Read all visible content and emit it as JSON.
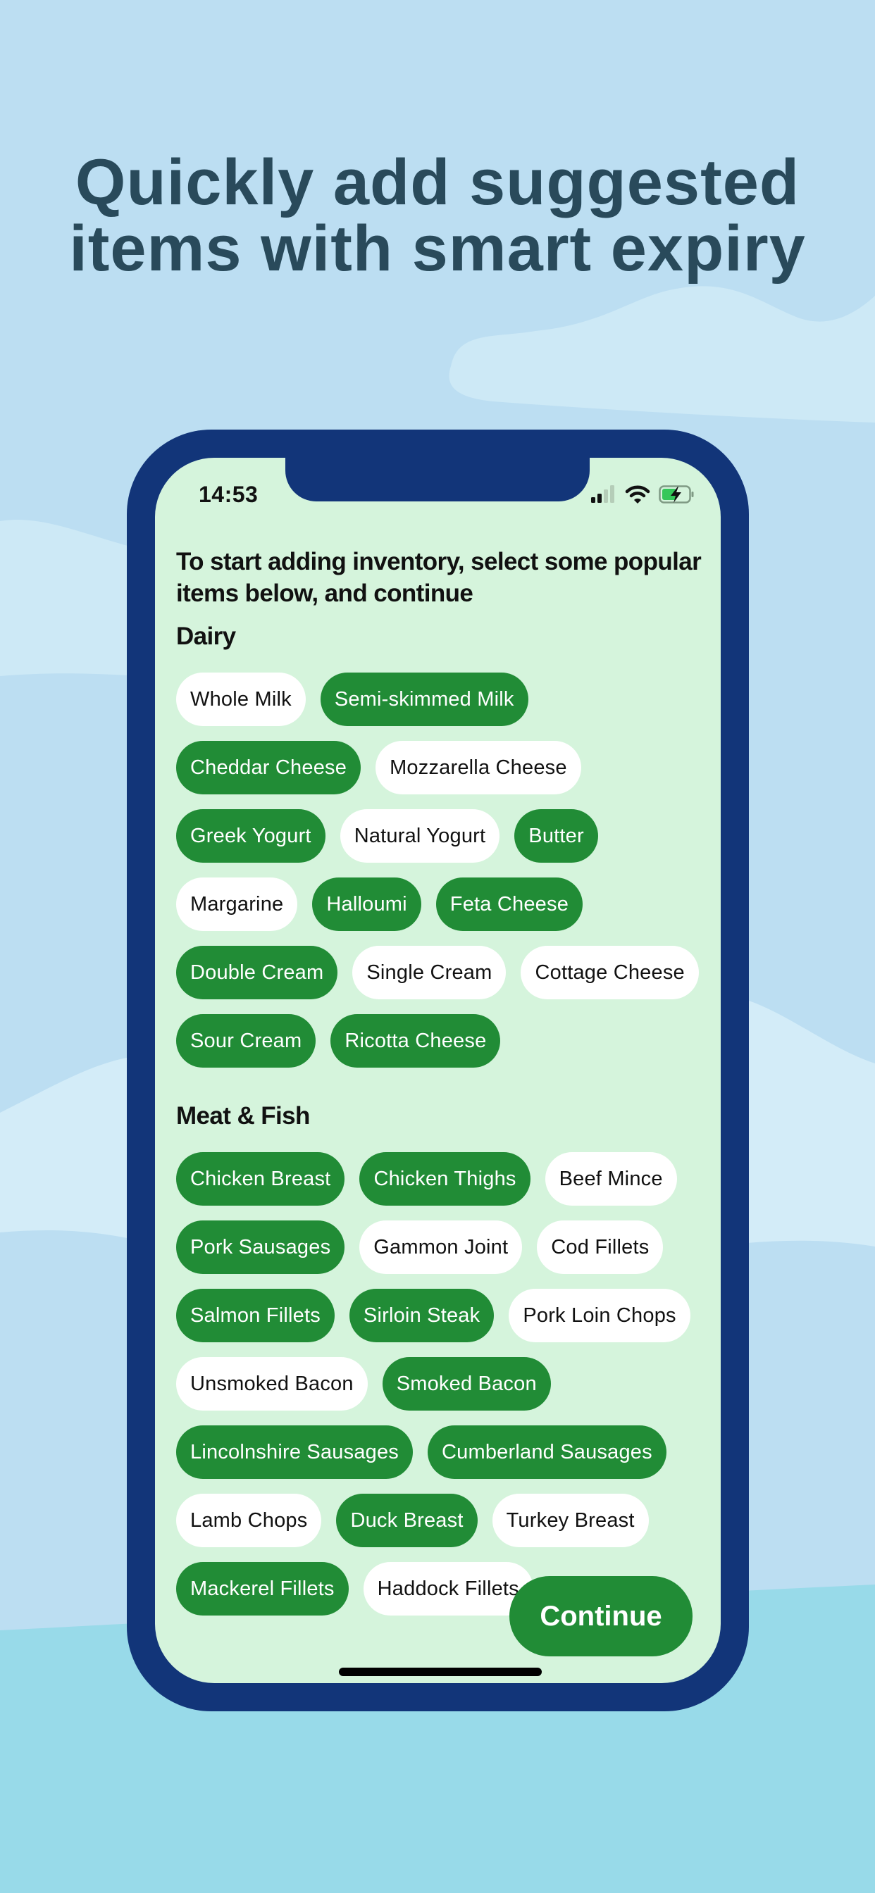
{
  "colors": {
    "sky": "#bcdef2",
    "cloud": "#cde9f6",
    "water": "#98dae9",
    "headline": "#294a5b",
    "frame": "#123579",
    "screen": "#d5f4dc",
    "accent_green": "#218c36",
    "chip_unselected": "#ffffff",
    "battery": "#34c759"
  },
  "headline": {
    "line1": "Quickly add suggested",
    "line2": "items with smart expiry"
  },
  "status_bar": {
    "time": "14:53",
    "icons": [
      "cellular-signal-icon",
      "wifi-icon",
      "battery-charging-icon"
    ]
  },
  "screen": {
    "intro_text": "To start adding inventory, select some popular items below, and continue",
    "sections": [
      {
        "title": "Dairy",
        "items": [
          {
            "label": "Whole Milk",
            "selected": false
          },
          {
            "label": "Semi-skimmed Milk",
            "selected": true
          },
          {
            "label": "Cheddar Cheese",
            "selected": true
          },
          {
            "label": "Mozzarella Cheese",
            "selected": false
          },
          {
            "label": "Greek Yogurt",
            "selected": true
          },
          {
            "label": "Natural Yogurt",
            "selected": false
          },
          {
            "label": "Butter",
            "selected": true
          },
          {
            "label": "Margarine",
            "selected": false
          },
          {
            "label": "Halloumi",
            "selected": true
          },
          {
            "label": "Feta Cheese",
            "selected": true
          },
          {
            "label": "Double Cream",
            "selected": true
          },
          {
            "label": "Single Cream",
            "selected": false
          },
          {
            "label": "Cottage Cheese",
            "selected": false
          },
          {
            "label": "Sour Cream",
            "selected": true
          },
          {
            "label": "Ricotta Cheese",
            "selected": true
          }
        ]
      },
      {
        "title": "Meat & Fish",
        "items": [
          {
            "label": "Chicken Breast",
            "selected": true
          },
          {
            "label": "Chicken Thighs",
            "selected": true
          },
          {
            "label": "Beef Mince",
            "selected": false
          },
          {
            "label": "Pork Sausages",
            "selected": true
          },
          {
            "label": "Gammon Joint",
            "selected": false
          },
          {
            "label": "Cod Fillets",
            "selected": false
          },
          {
            "label": "Salmon Fillets",
            "selected": true
          },
          {
            "label": "Sirloin Steak",
            "selected": true
          },
          {
            "label": "Pork Loin Chops",
            "selected": false
          },
          {
            "label": "Unsmoked Bacon",
            "selected": false
          },
          {
            "label": "Smoked Bacon",
            "selected": true
          },
          {
            "label": "Lincolnshire Sausages",
            "selected": true
          },
          {
            "label": "Cumberland Sausages",
            "selected": true
          },
          {
            "label": "Lamb Chops",
            "selected": false
          },
          {
            "label": "Duck Breast",
            "selected": true
          },
          {
            "label": "Turkey Breast",
            "selected": false
          },
          {
            "label": "Mackerel Fillets",
            "selected": true
          },
          {
            "label": "Haddock Fillets",
            "selected": false
          }
        ]
      }
    ],
    "continue_label": "Continue"
  }
}
